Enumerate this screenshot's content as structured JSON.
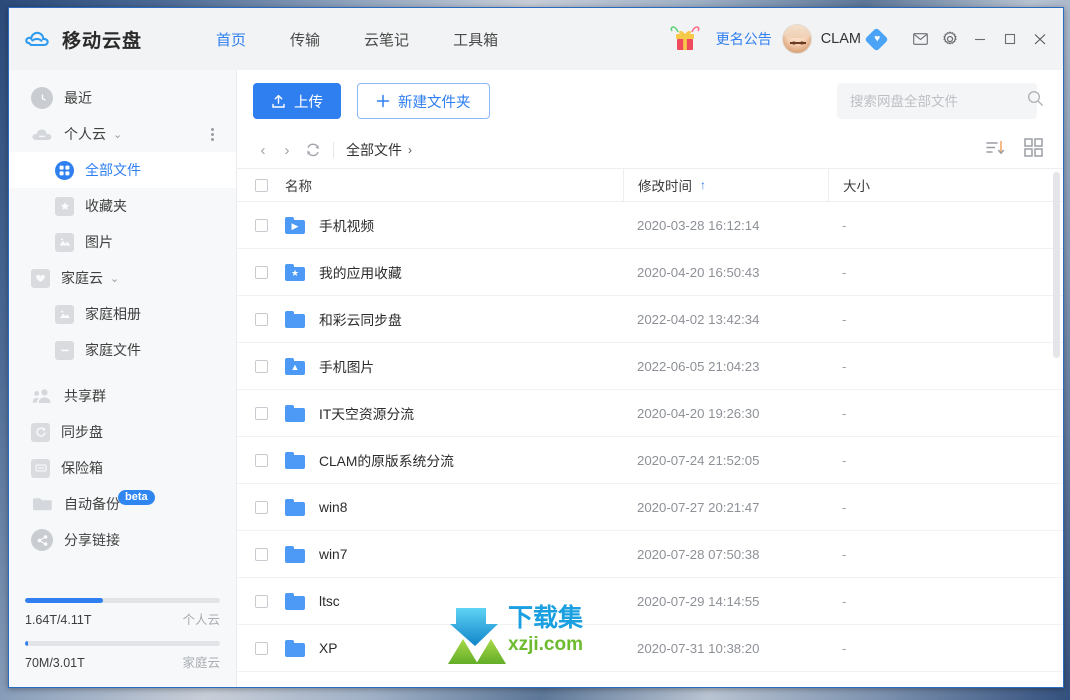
{
  "app": {
    "brand": "移动云盘",
    "logo_icon": "cloud-logo-icon",
    "accent_color": "#2f7ff0"
  },
  "titlebar": {
    "nav": [
      {
        "label": "首页",
        "active": true
      },
      {
        "label": "传输",
        "active": false
      },
      {
        "label": "云笔记",
        "active": false
      },
      {
        "label": "工具箱",
        "active": false
      }
    ],
    "gift_icon": "gift-icon",
    "notice_label": "更名公告",
    "avatar_icon": "user-avatar",
    "username": "CLAM",
    "vip_icon": "vip-diamond-icon",
    "mail_icon": "mail-icon",
    "settings_icon": "gear-icon",
    "minimize_icon": "minimize-icon",
    "maximize_icon": "maximize-icon",
    "close_icon": "close-icon"
  },
  "sidebar": {
    "items": [
      {
        "label": "最近",
        "icon": "clock-icon",
        "level": 0,
        "active": false,
        "caret": false,
        "menu": false
      },
      {
        "label": "个人云",
        "icon": "cloud-icon",
        "level": 0,
        "active": false,
        "caret": true,
        "menu": true
      },
      {
        "label": "全部文件",
        "icon": "grid-circle-icon",
        "level": 1,
        "active": true,
        "caret": false,
        "menu": false
      },
      {
        "label": "收藏夹",
        "icon": "star-folder-icon",
        "level": 1,
        "active": false,
        "caret": false,
        "menu": false
      },
      {
        "label": "图片",
        "icon": "image-icon",
        "level": 1,
        "active": false,
        "caret": false,
        "menu": false
      },
      {
        "label": "家庭云",
        "icon": "heart-icon",
        "level": 0,
        "active": false,
        "caret": true,
        "menu": false
      },
      {
        "label": "家庭相册",
        "icon": "album-icon",
        "level": 1,
        "active": false,
        "caret": false,
        "menu": false
      },
      {
        "label": "家庭文件",
        "icon": "folder-icon",
        "level": 1,
        "active": false,
        "caret": false,
        "menu": false
      },
      {
        "label": "共享群",
        "icon": "group-icon",
        "level": 0,
        "active": false,
        "caret": false,
        "menu": false
      },
      {
        "label": "同步盘",
        "icon": "sync-icon",
        "level": 0,
        "active": false,
        "caret": false,
        "menu": false
      },
      {
        "label": "保险箱",
        "icon": "safebox-icon",
        "level": 0,
        "active": false,
        "caret": false,
        "menu": false
      },
      {
        "label": "自动备份",
        "icon": "backup-folder-icon",
        "level": 0,
        "active": false,
        "caret": false,
        "menu": false,
        "badge": "beta"
      },
      {
        "label": "分享链接",
        "icon": "share-icon",
        "level": 0,
        "active": false,
        "caret": false,
        "menu": false
      }
    ],
    "storage": [
      {
        "used_label": "1.64T/4.11T",
        "name": "个人云",
        "percent": 40
      },
      {
        "used_label": "70M/3.01T",
        "name": "家庭云",
        "percent": 1
      }
    ]
  },
  "toolbar": {
    "upload_label": "上传",
    "upload_icon": "upload-icon",
    "newfolder_label": "新建文件夹",
    "newfolder_icon": "plus-icon",
    "search_placeholder": "搜索网盘全部文件",
    "search_value": "",
    "search_icon": "search-icon"
  },
  "crumbbar": {
    "back_icon": "chevron-left-icon",
    "forward_icon": "chevron-right-icon",
    "refresh_icon": "refresh-icon",
    "crumb_label": "全部文件",
    "crumb_arrow": "›",
    "sort_icon": "sort-icon",
    "grid_icon": "grid-view-icon"
  },
  "table": {
    "headers": {
      "name": "名称",
      "time": "修改时间",
      "size": "大小",
      "sort_arrow": "↑"
    },
    "rows": [
      {
        "name": "手机视频",
        "icon": "video-folder-icon",
        "glyph": "▶",
        "time": "2020-03-28 16:12:14",
        "size": "-"
      },
      {
        "name": "我的应用收藏",
        "icon": "star-folder-icon",
        "glyph": "★",
        "time": "2020-04-20 16:50:43",
        "size": "-"
      },
      {
        "name": "和彩云同步盘",
        "icon": "folder-icon",
        "glyph": "",
        "time": "2022-04-02 13:42:34",
        "size": "-"
      },
      {
        "name": "手机图片",
        "icon": "image-folder-icon",
        "glyph": "▲",
        "time": "2022-06-05 21:04:23",
        "size": "-"
      },
      {
        "name": "IT天空资源分流",
        "icon": "folder-icon",
        "glyph": "",
        "time": "2020-04-20 19:26:30",
        "size": "-"
      },
      {
        "name": "CLAM的原版系统分流",
        "icon": "folder-icon",
        "glyph": "",
        "time": "2020-07-24 21:52:05",
        "size": "-"
      },
      {
        "name": "win8",
        "icon": "folder-icon",
        "glyph": "",
        "time": "2020-07-27 20:21:47",
        "size": "-"
      },
      {
        "name": "win7",
        "icon": "folder-icon",
        "glyph": "",
        "time": "2020-07-28 07:50:38",
        "size": "-"
      },
      {
        "name": "ltsc",
        "icon": "folder-icon",
        "glyph": "",
        "time": "2020-07-29 14:14:55",
        "size": "-"
      },
      {
        "name": "XP",
        "icon": "folder-icon",
        "glyph": "",
        "time": "2020-07-31 10:38:20",
        "size": "-"
      }
    ]
  },
  "watermark": {
    "text_cn": "下载集",
    "text_en": "xzji.com",
    "arrow_color": "#1a9fe0",
    "x_color": "#7cbf33"
  }
}
